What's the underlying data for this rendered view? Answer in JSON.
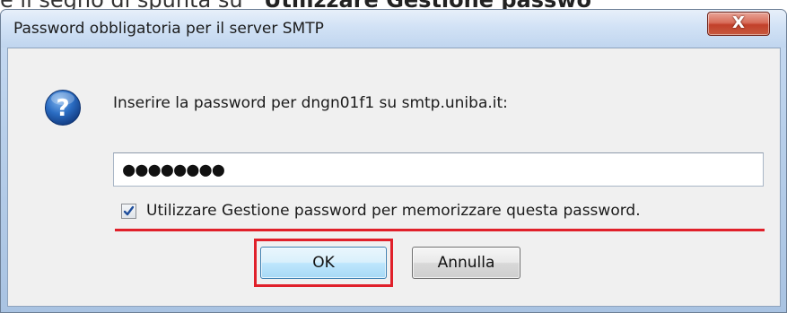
{
  "document_snippet": {
    "text_regular": "e il segno di spunta su ",
    "text_bold": "“Utilizzare Gestione passwo"
  },
  "dialog": {
    "title": "Password obbligatoria per il server SMTP",
    "close_label": "X",
    "icon": "question-icon",
    "prompt": "Inserire la password per dngn01f1 su smtp.uniba.it:",
    "password_value": "●●●●●●●●",
    "remember_label": "Utilizzare Gestione password per memorizzare questa password.",
    "remember_checked": true,
    "ok_label": "OK",
    "cancel_label": "Annulla"
  },
  "colors": {
    "highlight_red": "#e0202a",
    "question_blue": "#1f5fb0",
    "close_red": "#c2402a"
  }
}
